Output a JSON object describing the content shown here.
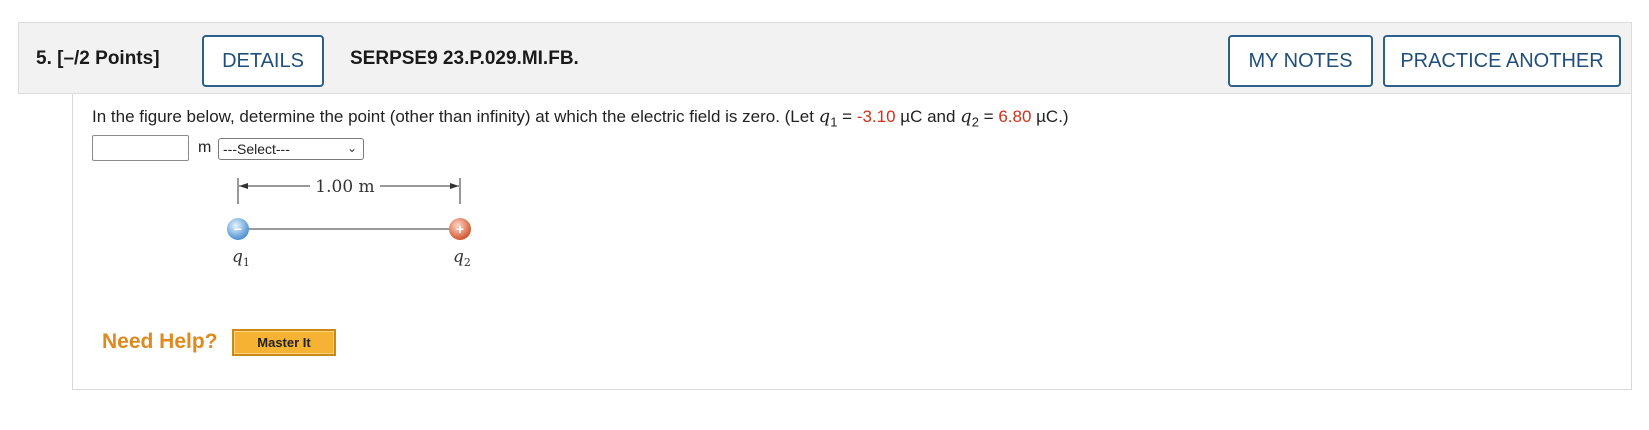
{
  "question": {
    "number_label": "5.  [–/2 Points]",
    "details_label": "DETAILS",
    "code": "SERPSE9 23.P.029.MI.FB.",
    "my_notes_label": "MY NOTES",
    "practice_label": "PRACTICE ANOTHER"
  },
  "prompt": {
    "text_before": "In the figure below, determine the point (other than infinity) at which the electric field is zero. (Let ",
    "q1_var": "q",
    "q1_sub": "1",
    "eq1": " = ",
    "q1_value": "-3.10",
    "unit1": " µC and ",
    "q2_var": "q",
    "q2_sub": "2",
    "eq2": " = ",
    "q2_value": "6.80",
    "unit2": " µC.)"
  },
  "answer": {
    "value": "",
    "unit": "m",
    "select_value": "---Select---"
  },
  "figure": {
    "distance_label": "1.00 m",
    "q1_label": "q",
    "q1_sub": "1",
    "q2_label": "q",
    "q2_sub": "2",
    "q1_sign": "−",
    "q2_sign": "+"
  },
  "help": {
    "need_help_label": "Need Help?",
    "master_it_label": "Master It"
  },
  "colors": {
    "accent": "#2c5f8a",
    "value_red": "#d0311a",
    "help_orange": "#e08a1e",
    "master_bg": "#f6b333"
  }
}
